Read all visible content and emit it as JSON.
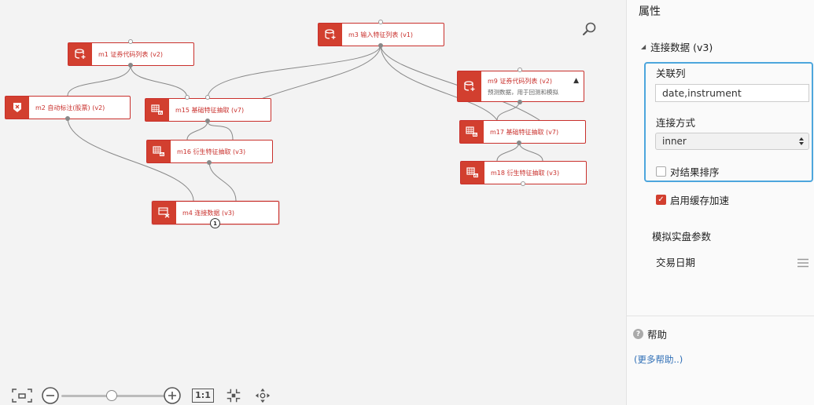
{
  "canvas": {
    "nodes": [
      {
        "id": "m1",
        "label": "m1 证券代码列表 (v2)",
        "icon": "database-add-icon"
      },
      {
        "id": "m2",
        "label": "m2 自动标注(股票) (v2)",
        "icon": "tag-icon"
      },
      {
        "id": "m3",
        "label": "m3 输入特征列表 (v1)",
        "icon": "database-add-icon"
      },
      {
        "id": "m9",
        "label": "m9 证券代码列表 (v2)",
        "sub": "预测数据，用于回测和模拟",
        "icon": "database-add-icon"
      },
      {
        "id": "m15",
        "label": "m15 基础特征抽取 (v7)",
        "icon": "grid-chart-icon"
      },
      {
        "id": "m16",
        "label": "m16 衍生特征抽取 (v3)",
        "icon": "grid-chart-icon"
      },
      {
        "id": "m17",
        "label": "m17 基础特征抽取 (v7)",
        "icon": "grid-chart-icon"
      },
      {
        "id": "m18",
        "label": "m18 衍生特征抽取 (v3)",
        "icon": "grid-chart-icon"
      },
      {
        "id": "m4",
        "label": "m4 连接数据 (v3)",
        "icon": "join-icon",
        "badge": "1"
      }
    ],
    "collapse_glyph": "▲"
  },
  "toolbar": {
    "fit_icon": "fit-screen-icon",
    "zoom_out": "−",
    "zoom_in": "+",
    "zoom_level": 0.45,
    "actual_size": "1:1",
    "focus_icon": "focus-icon",
    "move_icon": "move-icon"
  },
  "panel": {
    "title": "属性",
    "section": "连接数据 (v3)",
    "join_column_label": "关联列",
    "join_column_value": "date,instrument",
    "join_type_label": "连接方式",
    "join_type_value": "inner",
    "sort_label": "对结果排序",
    "sort_checked": false,
    "cache_label": "启用缓存加速",
    "cache_checked": true,
    "sim_head": "模拟实盘参数",
    "trade_date_label": "交易日期",
    "help_title": "帮助",
    "more_help": "(更多帮助..)"
  },
  "colors": {
    "accent": "#d23f2f",
    "focus_border": "#4da6dd",
    "link": "#2f6fb6"
  }
}
